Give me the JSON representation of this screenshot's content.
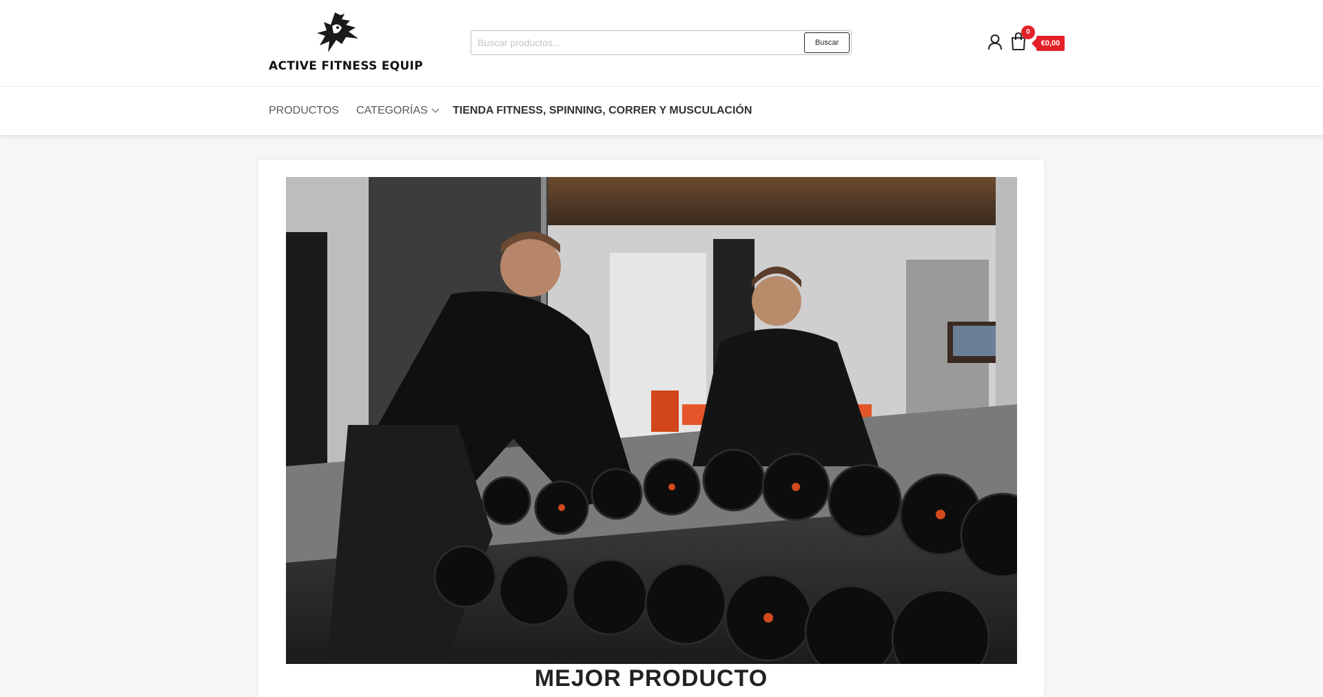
{
  "header": {
    "logo_text": "ACTIVE FITNESS EQUIP",
    "search": {
      "placeholder": "Buscar productos...",
      "value": "",
      "button_label": "Buscar"
    },
    "icons": [
      "user-icon",
      "shopping-bag-icon"
    ],
    "cart": {
      "count": "0",
      "total": "€0,00"
    }
  },
  "nav": {
    "items": [
      {
        "label": "PRODUCTOS"
      },
      {
        "label": "CATEGORÍAS",
        "has_dropdown": true
      },
      {
        "label": "TIENDA FITNESS, SPINNING, CORRER Y MUSCULACIÓN"
      }
    ]
  },
  "main": {
    "hero_image": "gym-photo",
    "heading": "MEJOR PRODUCTO"
  },
  "colors": {
    "accent": "#e32027",
    "page_background": "#f6f6f6",
    "nav_text": "#5a5a5a"
  }
}
